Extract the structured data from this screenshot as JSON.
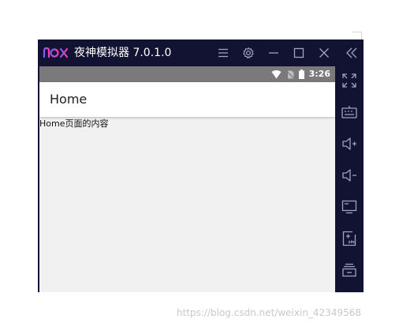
{
  "window": {
    "app_title": "夜神模拟器 7.0.1.0",
    "logo_text": "nox"
  },
  "statusbar": {
    "time": "3:26"
  },
  "appbar": {
    "title": "Home"
  },
  "content": {
    "text": "Home页面的内容"
  },
  "watermark": {
    "text": "https://blog.csdn.net/weixin_42349568"
  },
  "titlebar_buttons": [
    "menu-icon",
    "gear-icon",
    "minimize-icon",
    "maximize-icon",
    "close-icon",
    "collapse-icon"
  ],
  "sidebar_buttons": [
    "fullscreen-icon",
    "keyboard-icon",
    "volume-up-icon",
    "volume-down-icon",
    "screen-icon",
    "apk-install-icon",
    "multi-instance-icon"
  ],
  "colors": {
    "frame": "#121332",
    "statusbar": "#7a7a7a",
    "screen_bg": "#f1f1f1",
    "logo_gradient_start": "#7b5cff",
    "logo_gradient_end": "#ff3fa0"
  }
}
